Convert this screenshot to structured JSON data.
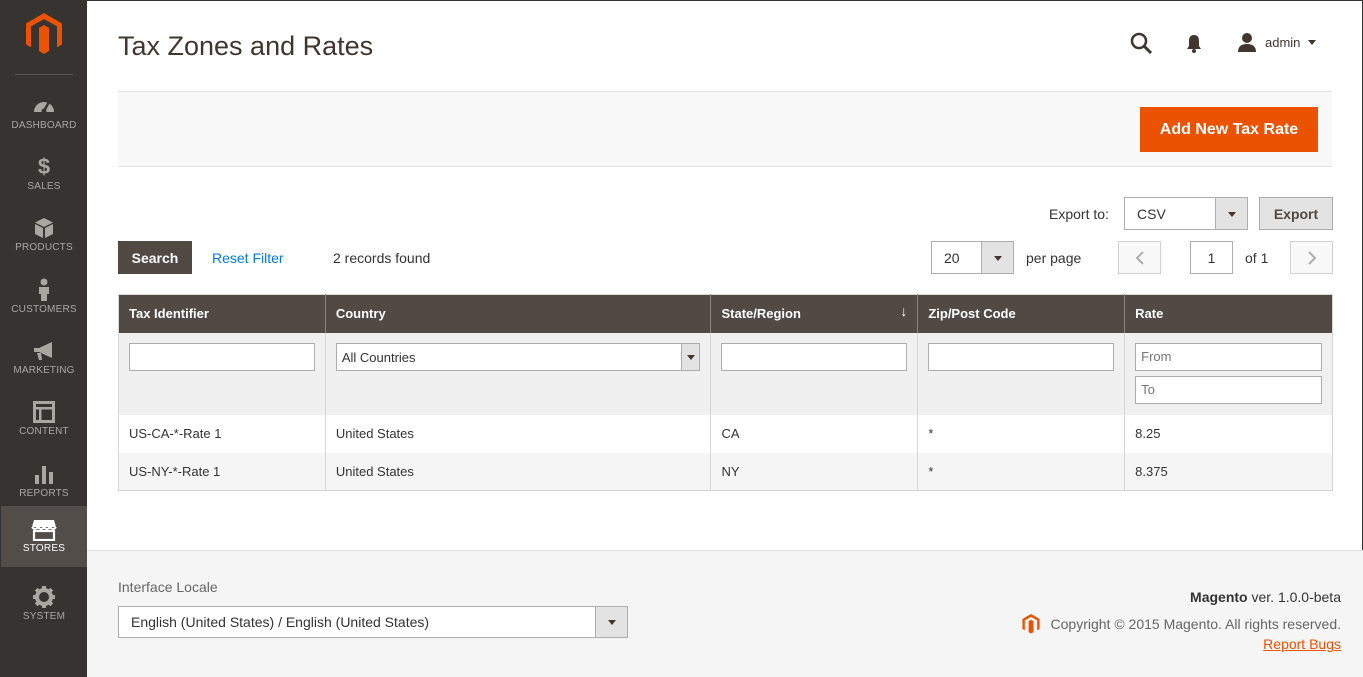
{
  "sidebar": {
    "items": [
      {
        "label": "DASHBOARD",
        "icon": "dashboard-icon"
      },
      {
        "label": "SALES",
        "icon": "dollar-icon"
      },
      {
        "label": "PRODUCTS",
        "icon": "box-icon"
      },
      {
        "label": "CUSTOMERS",
        "icon": "person-icon"
      },
      {
        "label": "MARKETING",
        "icon": "megaphone-icon"
      },
      {
        "label": "CONTENT",
        "icon": "layout-icon"
      },
      {
        "label": "REPORTS",
        "icon": "bar-chart-icon"
      },
      {
        "label": "STORES",
        "icon": "store-icon",
        "active": true
      },
      {
        "label": "SYSTEM",
        "icon": "gear-icon"
      }
    ]
  },
  "header": {
    "title": "Tax Zones and Rates",
    "user": "admin"
  },
  "actions": {
    "add_new": "Add New Tax Rate"
  },
  "export": {
    "label": "Export to:",
    "format": "CSV",
    "button": "Export"
  },
  "grid_controls": {
    "search": "Search",
    "reset": "Reset Filter",
    "records": "2 records found",
    "per_page_value": "20",
    "per_page_label": "per page",
    "page": "1",
    "of": "of 1"
  },
  "table": {
    "columns": [
      "Tax Identifier",
      "Country",
      "State/Region",
      "Zip/Post Code",
      "Rate"
    ],
    "filters": {
      "country": "All Countries",
      "rate_from": "From",
      "rate_to": "To"
    },
    "rows": [
      {
        "id": "US-CA-*-Rate 1",
        "country": "United States",
        "region": "CA",
        "zip": "*",
        "rate": "8.25"
      },
      {
        "id": "US-NY-*-Rate 1",
        "country": "United States",
        "region": "NY",
        "zip": "*",
        "rate": "8.375"
      }
    ]
  },
  "footer": {
    "locale_label": "Interface Locale",
    "locale_value": "English (United States) / English (United States)",
    "brand": "Magento",
    "version": "ver. 1.0.0-beta",
    "copyright": "Copyright © 2015 Magento. All rights reserved.",
    "report_bugs": "Report Bugs"
  },
  "colors": {
    "accent": "#eb5202",
    "sidebar": "#373330",
    "table_header": "#514943",
    "link": "#007bdb"
  }
}
